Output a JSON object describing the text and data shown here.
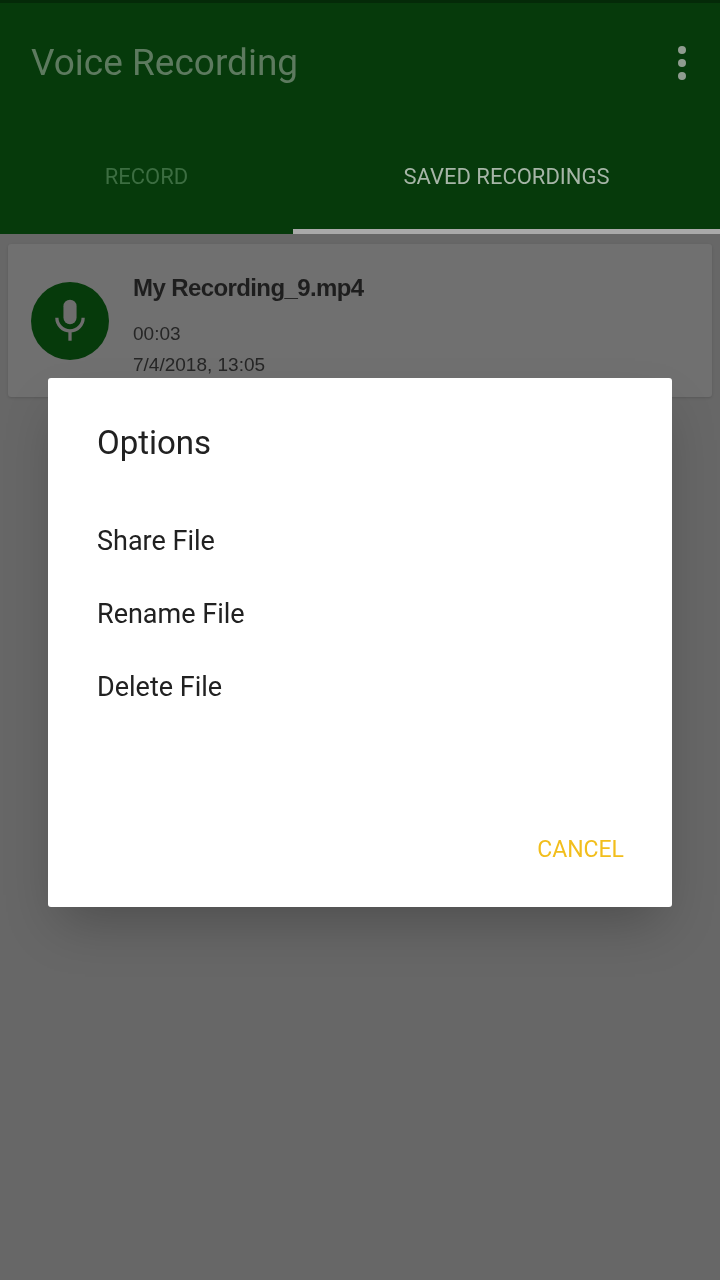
{
  "app_bar": {
    "title": "Voice Recording"
  },
  "tabs": [
    {
      "label": "RECORD",
      "selected": false
    },
    {
      "label": "SAVED RECORDINGS",
      "selected": true
    }
  ],
  "recordings": [
    {
      "name": "My Recording_9.mp4",
      "duration": "00:03",
      "date": "7/4/2018, 13:05"
    }
  ],
  "dialog": {
    "title": "Options",
    "options": [
      "Share File",
      "Rename File",
      "Delete File"
    ],
    "cancel": "CANCEL"
  }
}
